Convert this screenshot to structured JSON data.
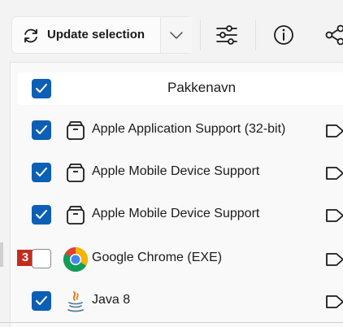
{
  "toolbar": {
    "update_label": "Update selection",
    "icons": [
      "refresh-icon",
      "chevron-down-icon",
      "sliders-icon",
      "info-icon",
      "share-icon"
    ]
  },
  "list": {
    "header": "Pakkenavn",
    "header_checked": true,
    "rows": [
      {
        "name": "Apple Application Support (32-bit)",
        "checked": true,
        "icon": "package-icon"
      },
      {
        "name": "Apple Mobile Device Support",
        "checked": true,
        "icon": "package-icon"
      },
      {
        "name": "Apple Mobile Device Support",
        "checked": true,
        "icon": "package-icon"
      },
      {
        "name": "Google Chrome (EXE)",
        "checked": false,
        "icon": "chrome-icon",
        "badge": "3"
      },
      {
        "name": "Java 8",
        "checked": true,
        "icon": "java-icon"
      }
    ]
  },
  "colors": {
    "accent": "#0c5fb5",
    "badge": "#c42b1c"
  }
}
